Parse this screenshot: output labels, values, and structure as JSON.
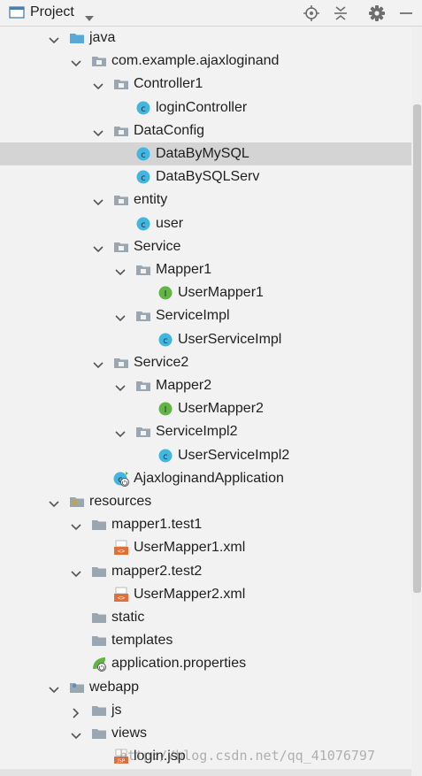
{
  "header": {
    "title": "Project",
    "tools": [
      {
        "name": "locate-icon"
      },
      {
        "name": "collapse-all-icon"
      },
      {
        "name": "gear-icon"
      },
      {
        "name": "minimize-icon"
      }
    ]
  },
  "colors": {
    "folder": "#9aa7b0",
    "java_folder": "#59a8d8",
    "class_icon": "#40b6e0",
    "interface_icon": "#62b543",
    "xml_icon": "#e0703a",
    "selection": "#d4d4d4"
  },
  "tree": [
    {
      "label": "java",
      "icon": "source-folder-icon",
      "arrow": "down",
      "depth": 3
    },
    {
      "label": "com.example.ajaxloginand",
      "icon": "package-icon",
      "arrow": "down",
      "depth": 4
    },
    {
      "label": "Controller1",
      "icon": "package-icon",
      "arrow": "down",
      "depth": 5
    },
    {
      "label": "loginController",
      "icon": "class-icon",
      "arrow": "none",
      "depth": 6
    },
    {
      "label": "DataConfig",
      "icon": "package-icon",
      "arrow": "down",
      "depth": 5
    },
    {
      "label": "DataByMySQL",
      "icon": "class-icon",
      "arrow": "none",
      "depth": 6,
      "selected": true
    },
    {
      "label": "DataBySQLServ",
      "icon": "class-icon",
      "arrow": "none",
      "depth": 6
    },
    {
      "label": "entity",
      "icon": "package-icon",
      "arrow": "down",
      "depth": 5
    },
    {
      "label": "user",
      "icon": "class-icon",
      "arrow": "none",
      "depth": 6
    },
    {
      "label": "Service",
      "icon": "package-icon",
      "arrow": "down",
      "depth": 5
    },
    {
      "label": "Mapper1",
      "icon": "package-icon",
      "arrow": "down",
      "depth": 6
    },
    {
      "label": "UserMapper1",
      "icon": "interface-icon",
      "arrow": "none",
      "depth": 7
    },
    {
      "label": "ServiceImpl",
      "icon": "package-icon",
      "arrow": "down",
      "depth": 6
    },
    {
      "label": "UserServiceImpl",
      "icon": "class-icon",
      "arrow": "none",
      "depth": 7
    },
    {
      "label": "Service2",
      "icon": "package-icon",
      "arrow": "down",
      "depth": 5
    },
    {
      "label": "Mapper2",
      "icon": "package-icon",
      "arrow": "down",
      "depth": 6
    },
    {
      "label": "UserMapper2",
      "icon": "interface-icon",
      "arrow": "none",
      "depth": 7
    },
    {
      "label": "ServiceImpl2",
      "icon": "package-icon",
      "arrow": "down",
      "depth": 6
    },
    {
      "label": "UserServiceImpl2",
      "icon": "class-icon",
      "arrow": "none",
      "depth": 7
    },
    {
      "label": "AjaxloginandApplication",
      "icon": "spring-boot-class-icon",
      "arrow": "none",
      "depth": 5
    },
    {
      "label": "resources",
      "icon": "resources-folder-icon",
      "arrow": "down",
      "depth": 3
    },
    {
      "label": "mapper1.test1",
      "icon": "folder-icon",
      "arrow": "down",
      "depth": 4
    },
    {
      "label": "UserMapper1.xml",
      "icon": "xml-file-icon",
      "arrow": "none",
      "depth": 5
    },
    {
      "label": "mapper2.test2",
      "icon": "folder-icon",
      "arrow": "down",
      "depth": 4
    },
    {
      "label": "UserMapper2.xml",
      "icon": "xml-file-icon",
      "arrow": "none",
      "depth": 5
    },
    {
      "label": "static",
      "icon": "folder-icon",
      "arrow": "none",
      "depth": 4
    },
    {
      "label": "templates",
      "icon": "folder-icon",
      "arrow": "none",
      "depth": 4
    },
    {
      "label": "application.properties",
      "icon": "spring-properties-icon",
      "arrow": "none",
      "depth": 4
    },
    {
      "label": "webapp",
      "icon": "web-folder-icon",
      "arrow": "down",
      "depth": 3
    },
    {
      "label": "js",
      "icon": "folder-icon",
      "arrow": "right",
      "depth": 4
    },
    {
      "label": "views",
      "icon": "folder-icon",
      "arrow": "down",
      "depth": 4
    },
    {
      "label": "login.jsp",
      "icon": "jsp-file-icon",
      "arrow": "none",
      "depth": 5
    }
  ],
  "watermark": "http://blog.csdn.net/qq_41076797"
}
